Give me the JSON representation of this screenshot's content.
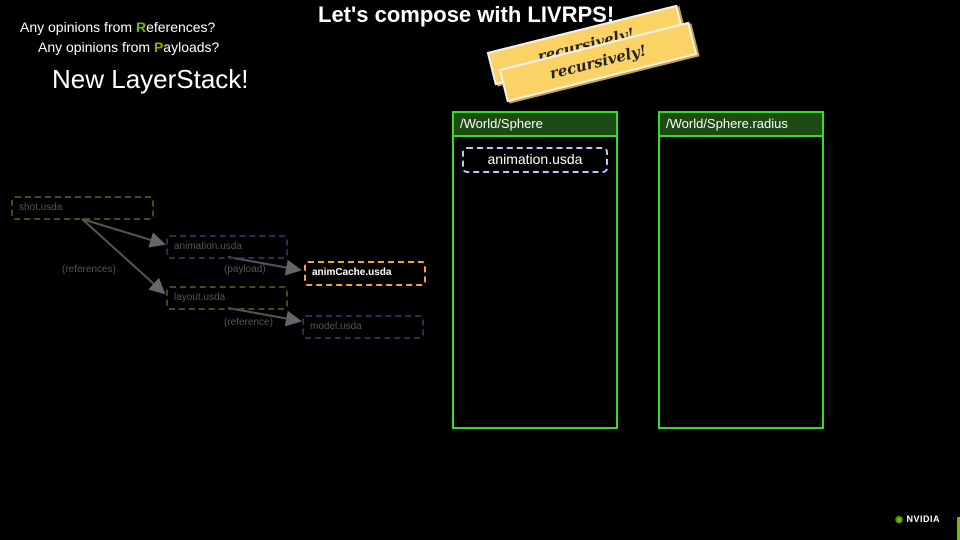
{
  "title": "Let's compose with LIVRPS!",
  "questions": [
    {
      "prefix": "Any opinions from ",
      "highlight": "R",
      "suffix": "eferences?"
    },
    {
      "prefix": "Any opinions from ",
      "highlight": "P",
      "suffix": "ayloads?"
    }
  ],
  "new_layerstack": "New LayerStack!",
  "stamps": [
    "recursively!",
    "recursively!"
  ],
  "panels": {
    "prim": {
      "header": "/World/Sphere",
      "chip": "animation.usda"
    },
    "attr": {
      "header": "/World/Sphere.radius"
    }
  },
  "graph": {
    "nodes": {
      "shot": "shot.usda",
      "animation": "animation.usda",
      "layout": "layout.usda",
      "animcache": "animCache.usda",
      "model": "model.usda"
    },
    "edge_labels": {
      "references": "(references)",
      "payload": "(payload)",
      "reference": "(reference)"
    }
  },
  "brand": {
    "logo": "NVIDIA"
  },
  "colors": {
    "accent_green": "#33dd22",
    "header_green": "#1d4a12",
    "stamp_yellow": "#fbd266",
    "chip_border": "#b8c8ff",
    "animcache_orange": "#f5a623",
    "nvidia_green": "#76b900"
  }
}
